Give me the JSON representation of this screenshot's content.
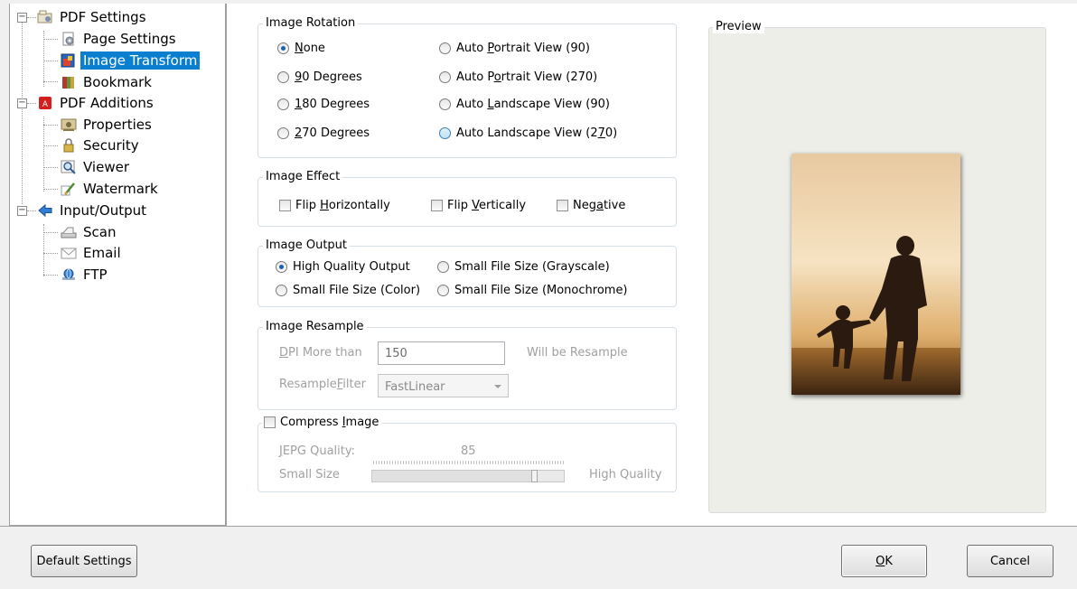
{
  "tree": {
    "items": [
      {
        "label": "PDF Settings",
        "icon": "settings-folder-icon"
      },
      {
        "label": "Page Settings",
        "icon": "page-settings-icon"
      },
      {
        "label": "Image Transform",
        "icon": "image-transform-icon"
      },
      {
        "label": "Bookmark",
        "icon": "bookmark-icon"
      },
      {
        "label": "PDF Additions",
        "icon": "pdf-icon"
      },
      {
        "label": "Properties",
        "icon": "properties-icon"
      },
      {
        "label": "Security",
        "icon": "security-lock-icon"
      },
      {
        "label": "Viewer",
        "icon": "viewer-magnifier-icon"
      },
      {
        "label": "Watermark",
        "icon": "watermark-brush-icon"
      },
      {
        "label": "Input/Output",
        "icon": "input-output-arrow-icon"
      },
      {
        "label": "Scan",
        "icon": "scanner-icon"
      },
      {
        "label": "Email",
        "icon": "email-envelope-icon"
      },
      {
        "label": "FTP",
        "icon": "ftp-globe-icon"
      }
    ],
    "selected": "Image Transform"
  },
  "rotation": {
    "title": "Image Rotation",
    "none_pre": "",
    "none_key": "N",
    "none_post": "one",
    "deg90_pre": "",
    "deg90_key": "9",
    "deg90_post": "0 Degrees",
    "deg180_pre": "",
    "deg180_key": "1",
    "deg180_post": "80 Degrees",
    "deg270_pre": "",
    "deg270_key": "2",
    "deg270_post": "70 Degrees",
    "ap90_pre": "Auto ",
    "ap90_key": "P",
    "ap90_post": "ortrait View (90)",
    "ap270_pre": "Auto P",
    "ap270_key": "o",
    "ap270_post": "rtrait View (270)",
    "al90_pre": "Auto ",
    "al90_key": "L",
    "al90_post": "andscape View (90)",
    "al270_pre": "Auto Landscape View (2",
    "al270_key": "7",
    "al270_post": "0)",
    "selected": "None"
  },
  "effect": {
    "title": "Image Effect",
    "flip_h_pre": "Flip ",
    "flip_h_key": "H",
    "flip_h_post": "orizontally",
    "flip_v_pre": "Flip ",
    "flip_v_key": "V",
    "flip_v_post": "ertically",
    "neg_pre": "Neg",
    "neg_key": "a",
    "neg_post": "tive"
  },
  "output": {
    "title": "Image Output",
    "high": "High Quality Output",
    "small_color": "Small File Size (Color)",
    "small_gray": "Small File Size (Grayscale)",
    "small_mono": "Small File Size (Monochrome)",
    "selected": "High Quality Output"
  },
  "resample": {
    "title": "Image Resample",
    "dpi_pre": "",
    "dpi_key": "D",
    "dpi_post": "PI More than",
    "dpi_value": "150",
    "will_be": "Will be Resample",
    "filter_pre": "Resample",
    "filter_key": "F",
    "filter_post": "ilter",
    "filter_value": "FastLinear"
  },
  "compress": {
    "title_pre": "Compress ",
    "title_key": "I",
    "title_post": "mage",
    "quality_pre": "",
    "quality_key": "J",
    "quality_post": "EPG Quality:",
    "quality_value": "85",
    "quality_fraction": 0.85,
    "small": "Small Size",
    "high": "High Quality"
  },
  "preview": {
    "title": "Preview"
  },
  "buttons": {
    "default_settings": "Default Settings",
    "ok_key": "O",
    "ok_post": "K",
    "cancel": "Cancel"
  },
  "colors": {
    "selection": "#0a7fd0",
    "sunset_top": "#f3ddb8",
    "sunset_bottom": "#b27a3c"
  }
}
